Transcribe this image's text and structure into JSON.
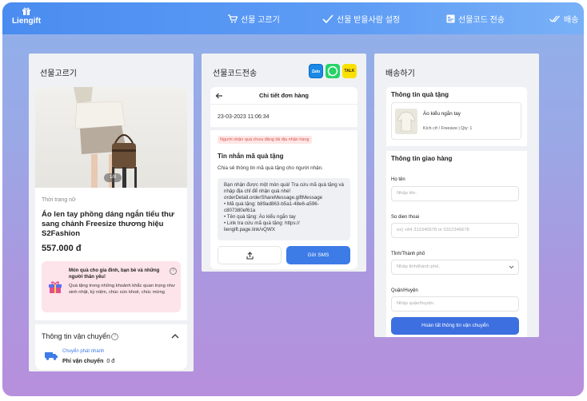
{
  "app": {
    "logo_text": "Liengift"
  },
  "nav": [
    {
      "label": "선물 고르기",
      "icon": "cart-icon"
    },
    {
      "label": "선물 받을사람 설정",
      "icon": "check-icon"
    },
    {
      "label": "선물코드 전송",
      "icon": "card-icon"
    },
    {
      "label": "배송",
      "icon": "double-check-icon"
    }
  ],
  "pick": {
    "title": "선물고르기",
    "pager": "1/8",
    "category": "Thời trang nữ",
    "product_name": "Áo len tay phồng dáng ngắn tiểu thư sang chảnh Freesize thương hiệu S2Fashion",
    "price": "557.000 đ",
    "promo_title": "Món quà cho gia đình, bạn bè và những người thân yêu!",
    "promo_desc": "Quà tặng trong những khoảnh khắc quan trọng như sinh nhật, kỷ niệm, chúc sức khoẻ, chúc mừng",
    "shipping_title": "Thông tin vận chuyển",
    "shipping_method": "Chuyển phát nhanh",
    "shipping_fee_label": "Phí vận chuyển",
    "shipping_fee_value": "0 đ"
  },
  "send": {
    "title": "선물코드전송",
    "apps": [
      "Zalo",
      "WhatsApp",
      "TALK"
    ],
    "order_header": "Chi tiết đơn hàng",
    "date": "23-03-2023 11:06:34",
    "warning": "Người nhận quà chưa đăng tải địa nhận hàng",
    "msg_title": "Tin nhắn mã quà tặng",
    "msg_desc": "Chia sẻ thông tin mã quà tặng cho người nhận.",
    "message": "Bạn nhận được một món quà! Tra cứu mã quà tặng và nhập địa chỉ để nhận quà nhé! orderDetail.orderShareMessage.giftMessage\n• Mã quà tặng:  b89ad863-b5a1-48e6-a596-c807380ef61a\n• Tên quà tặng:  Áo kiểu ngắn tay\n• Link tra cứu mã quà tặng:  https://\nliengift.page.link/vQWX",
    "sms_button": "Gửi SMS"
  },
  "delivery": {
    "title": "배송하기",
    "gift_section": "Thông tin quà tặng",
    "gift_name": "Áo kiểu ngắn tay",
    "gift_option": "Kích cỡ / Freesize | Qty: 1",
    "delivery_section": "Thông tin giao hàng",
    "name_label": "Họ tên",
    "name_placeholder": "Nhập tên.",
    "phone_label": "So dien thoai",
    "phone_placeholder": "ex) +84 312345678 or 0312345678",
    "province_label": "Tỉnh/Thành phố",
    "province_placeholder": "Nhập tỉnh/thành phố.",
    "district_label": "Quận/Huyện",
    "district_placeholder": "Nhập quận/huyện.",
    "submit": "Hoàn tất thông tin vận chuyển"
  },
  "colors": {
    "accent": "#3d7be6",
    "warning": "#d9534f",
    "promo_bg": "#fde4ea"
  }
}
